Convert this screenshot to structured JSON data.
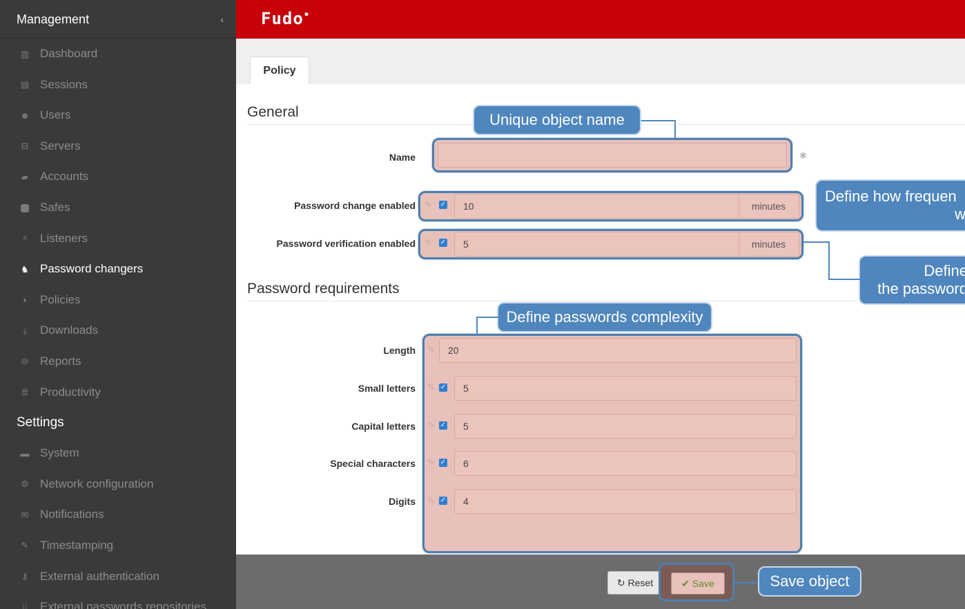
{
  "sidebar": {
    "management_title": "Management",
    "collapse_icon": "chevron-left-icon",
    "management_items": [
      {
        "label": "Dashboard",
        "icon": "bar-chart-icon"
      },
      {
        "label": "Sessions",
        "icon": "film-icon"
      },
      {
        "label": "Users",
        "icon": "users-icon"
      },
      {
        "label": "Servers",
        "icon": "server-icon"
      },
      {
        "label": "Accounts",
        "icon": "book-icon"
      },
      {
        "label": "Safes",
        "icon": "safe-icon"
      },
      {
        "label": "Listeners",
        "icon": "rss-icon"
      },
      {
        "label": "Password changers",
        "icon": "sitemap-icon",
        "active": true
      },
      {
        "label": "Policies",
        "icon": "shield-icon"
      },
      {
        "label": "Downloads",
        "icon": "download-icon"
      },
      {
        "label": "Reports",
        "icon": "print-icon"
      },
      {
        "label": "Productivity",
        "icon": "list-icon"
      }
    ],
    "settings_title": "Settings",
    "settings_items": [
      {
        "label": "System",
        "icon": "folder-icon"
      },
      {
        "label": "Network configuration",
        "icon": "cogs-icon"
      },
      {
        "label": "Notifications",
        "icon": "envelope-icon"
      },
      {
        "label": "Timestamping",
        "icon": "edit-icon"
      },
      {
        "label": "External authentication",
        "icon": "key-icon"
      },
      {
        "label": "External passwords repositories",
        "icon": "grid-icon"
      }
    ]
  },
  "topbar": {
    "logo": "Fudo",
    "logo_mark": "•",
    "brand_color": "#c8000a"
  },
  "tabs": [
    {
      "label": "Policy"
    }
  ],
  "general": {
    "title": "General",
    "name_label": "Name",
    "name_value": "",
    "required_mark": "✱",
    "pwd_change_label": "Password change enabled",
    "pwd_change_value": "10",
    "pwd_change_unit": "minutes",
    "pwd_verify_label": "Password verification enabled",
    "pwd_verify_value": "5",
    "pwd_verify_unit": "minutes"
  },
  "requirements": {
    "title": "Password requirements",
    "fields": [
      {
        "label": "Length",
        "value": "20",
        "checkbox": false
      },
      {
        "label": "Small letters",
        "value": "5",
        "checkbox": true
      },
      {
        "label": "Capital letters",
        "value": "5",
        "checkbox": true
      },
      {
        "label": "Special characters",
        "value": "6",
        "checkbox": true
      },
      {
        "label": "Digits",
        "value": "4",
        "checkbox": true
      }
    ]
  },
  "callouts": {
    "name": "Unique object name",
    "frequency_line1": "Define how frequen",
    "frequency_line2": "w",
    "verify_line1": "Define",
    "verify_line2": "the password",
    "complexity": "Define passwords complexity",
    "save": "Save object"
  },
  "footer": {
    "reset_label": "Reset",
    "save_label": "Save",
    "reset_icon": "refresh-icon",
    "save_icon": "check-icon"
  }
}
